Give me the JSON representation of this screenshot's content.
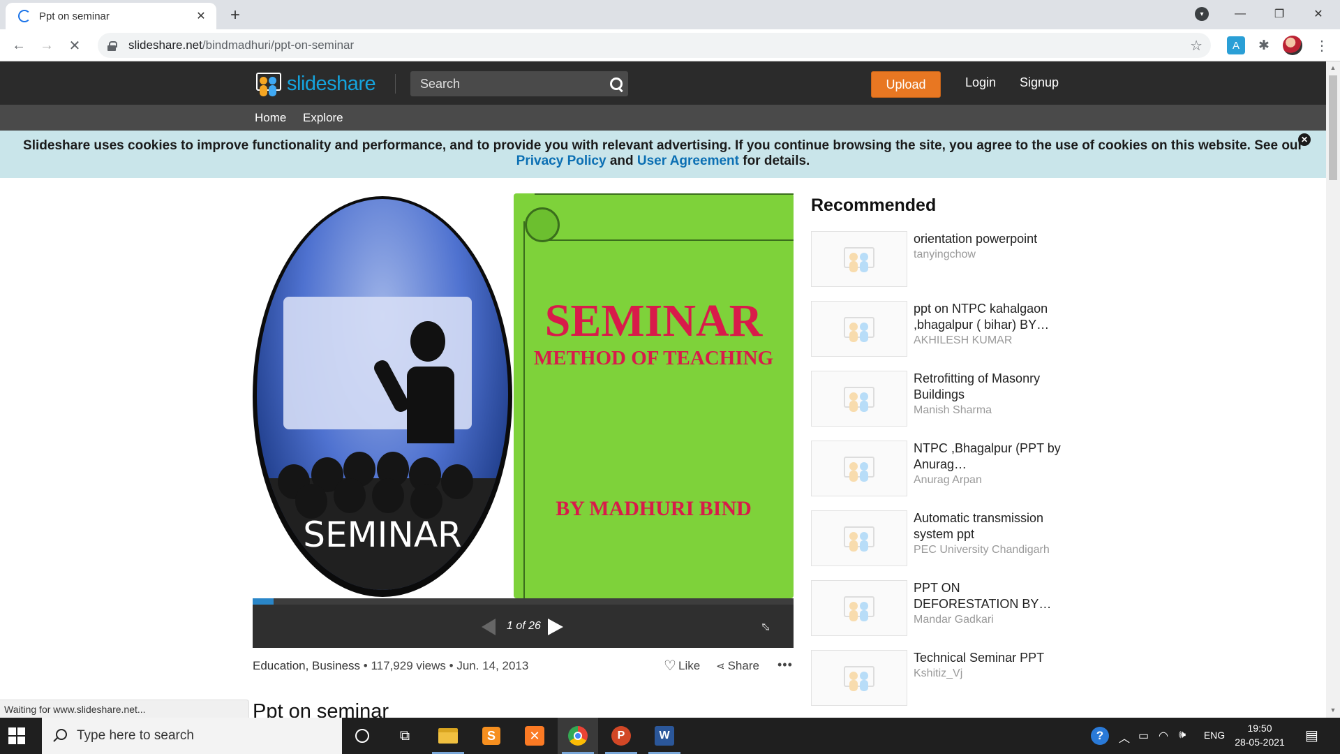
{
  "browser": {
    "tab_title": "Ppt on seminar",
    "url_host": "slideshare.net",
    "url_path": "/bindmadhuri/ppt-on-seminar",
    "status_text": "Waiting for www.slideshare.net..."
  },
  "header": {
    "logo_text": "slideshare",
    "search_placeholder": "Search",
    "upload_label": "Upload",
    "login_label": "Login",
    "signup_label": "Signup"
  },
  "subnav": {
    "home_label": "Home",
    "explore_label": "Explore"
  },
  "cookie": {
    "text": "Slideshare uses cookies to improve functionality and performance, and to provide you with relevant advertising. If you continue browsing the site, you agree to the use of cookies on this website. See our",
    "privacy_label": "Privacy Policy",
    "and_text": "and",
    "agreement_label": "User Agreement",
    "tail_text": "for details."
  },
  "slide": {
    "left_caption": "SEMINAR",
    "title": "SEMINAR",
    "subtitle": "METHOD OF TEACHING",
    "author_line": "BY MADHURI BIND",
    "current": 1,
    "total": 26,
    "page_label": "1 of 26",
    "progress_fraction": 0.0385
  },
  "meta": {
    "categories": "Education, Business",
    "views": "117,929 views",
    "date": "Jun. 14, 2013",
    "separator": "•",
    "like_label": "Like",
    "share_label": "Share"
  },
  "page_title": "Ppt on seminar",
  "recommended": {
    "heading": "Recommended",
    "items": [
      {
        "title": "orientation powerpoint",
        "author": "tanyingchow"
      },
      {
        "title": "ppt on NTPC kahalgaon ,bhagalpur ( bihar) BY…",
        "author": "AKHILESH KUMAR"
      },
      {
        "title": "Retrofitting of Masonry Buildings",
        "author": "Manish Sharma"
      },
      {
        "title": "NTPC ,Bhagalpur (PPT by Anurag…",
        "author": "Anurag Arpan"
      },
      {
        "title": "Automatic transmission system ppt",
        "author": "PEC University Chandigarh"
      },
      {
        "title": "PPT ON DEFORESTATION BY…",
        "author": "Mandar Gadkari"
      },
      {
        "title": "Technical Seminar PPT",
        "author": "Kshitiz_Vj"
      }
    ]
  },
  "taskbar": {
    "search_placeholder": "Type here to search",
    "language": "ENG",
    "time": "19:50",
    "date": "28-05-2021"
  },
  "colors": {
    "brand_blue": "#15a4de",
    "upload_orange": "#e87722",
    "slide_green": "#7ed23a",
    "slide_text_red": "#d81b4a",
    "cookie_bg": "#c9e5ea"
  }
}
